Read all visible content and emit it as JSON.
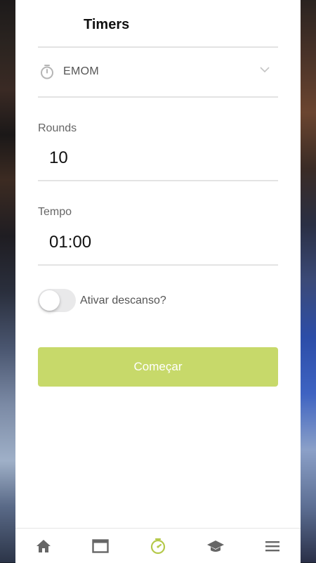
{
  "header": {
    "title": "Timers"
  },
  "timer_select": {
    "selected": "EMOM",
    "icon": "stopwatch-icon"
  },
  "rounds": {
    "label": "Rounds",
    "value": "10"
  },
  "tempo": {
    "label": "Tempo",
    "value": "01:00"
  },
  "rest_toggle": {
    "label": "Ativar descanso?",
    "on": false
  },
  "start_button": {
    "label": "Começar"
  },
  "tabbar": {
    "items": [
      {
        "icon": "home-icon",
        "active": false
      },
      {
        "icon": "calendar-icon",
        "active": false
      },
      {
        "icon": "timer-icon",
        "active": true
      },
      {
        "icon": "graduation-cap-icon",
        "active": false
      },
      {
        "icon": "menu-icon",
        "active": false
      }
    ]
  },
  "colors": {
    "accent": "#c7d96a",
    "active_tab": "#b5c94a",
    "inactive_tab": "#666666",
    "divider": "#e3e3e3"
  }
}
